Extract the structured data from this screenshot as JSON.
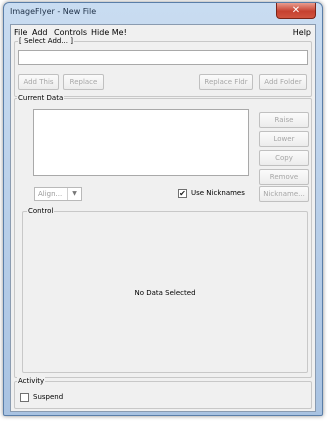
{
  "window": {
    "title": "ImageFlyer - New File",
    "close_symbol": "✕"
  },
  "menu": {
    "file": "File",
    "add": "Add",
    "controls": "Controls",
    "hide_me": "Hide Me!",
    "help": "Help"
  },
  "select_add": {
    "label": "[ Select Add... ]",
    "add_this": "Add This",
    "replace": "Replace",
    "replace_fldr": "Replace Fldr",
    "add_folder": "Add Folder"
  },
  "current_data": {
    "label": "Current Data",
    "raise": "Raise",
    "lower": "Lower",
    "copy": "Copy",
    "remove": "Remove",
    "align_value": "Align...",
    "use_nicknames_label": "Use Nicknames",
    "use_nicknames_checked": true,
    "nickname": "Nickname..."
  },
  "control": {
    "label": "Control",
    "empty_message": "No Data Selected"
  },
  "activity": {
    "label": "Activity",
    "suspend_label": "Suspend",
    "suspend_checked": false
  },
  "colors": {
    "title_gradient_top": "#c9dcf1",
    "close_red": "#c64130",
    "client_bg": "#f0f0f0"
  }
}
